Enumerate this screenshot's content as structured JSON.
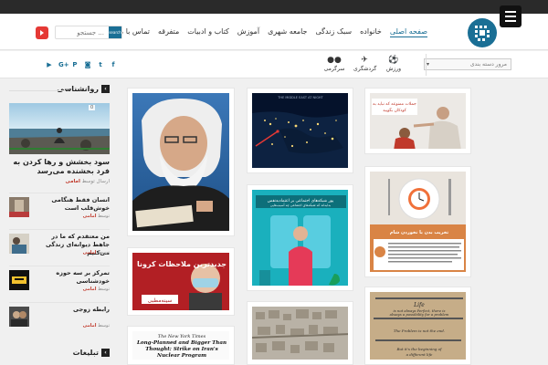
{
  "header": {
    "nav": [
      "صفحه اصلی",
      "خانواده",
      "سبک زندگی",
      "جامعه شهری",
      "آموزش",
      "کتاب و ادبیات",
      "متفرقه",
      "تماس با ما"
    ],
    "search_placeholder": "جستجو ...",
    "search_button": "search"
  },
  "subbar": {
    "select_placeholder": "مرور دسته بندی",
    "categories": [
      "ورزش",
      "گردشگری",
      "سرگرمی"
    ],
    "social_icons": [
      "youtube-icon",
      "google-plus-icon",
      "pinterest-icon",
      "instagram-icon",
      "twitter-icon",
      "facebook-icon"
    ]
  },
  "sidebar": {
    "section_title": "روانشناسی",
    "featured": {
      "badge": "0",
      "title": "سود بخشش و رها کردن به فرد بخشنده می‌رسد",
      "meta_prefix": "ارسال توسط",
      "author": "امامی"
    },
    "items": [
      {
        "title": "انسان فقط هنگامی خوش‌قلب است",
        "meta_prefix": "توسط",
        "author": "امامی"
      },
      {
        "title": "من معتقدم که ما در جاهط دیوانه‌ای زندگی می‌کنیم",
        "meta_prefix": "توسط",
        "author": "امامی"
      },
      {
        "title": "تمرکز بر سه حوزه خودشناسی",
        "meta_prefix": "توسط",
        "author": "امامی"
      },
      {
        "title": "رابطه زوجی",
        "meta_prefix": "توسط",
        "author": "امامی"
      }
    ],
    "ads_title": "تبلیغات"
  },
  "cards": {
    "nasa_label": "THE MIDDLE EAST AT NIGHT",
    "children_line1": "جملات ممنوعه که نباید به",
    "children_line2": "کودکان بگویید",
    "network_line1": "پور شبکه‌های اجتماعی بر اعتمادبه‌نفس",
    "network_line2": "بدایه‌اند که شبکه‌های اجتماعی چه آسیب‌هایی",
    "dinner_title": "تخریب بدن با نخوردن شام",
    "corona_title": "جدیدترین ملاحظات کرونا",
    "corona_sub": "سینه‌مطبی",
    "nyt_masthead": "The New York Times",
    "nyt_headline": "Long-Planned and Bigger Than Thought: Strike on Iran's Nuclear Program",
    "life_1": "Life",
    "life_2": "is not always Perfect, there is",
    "life_3": "always a possibility for a problem",
    "life_4": "The Problem is not the end.",
    "life_5": "But it's the beginning of",
    "life_6": "a different life"
  }
}
